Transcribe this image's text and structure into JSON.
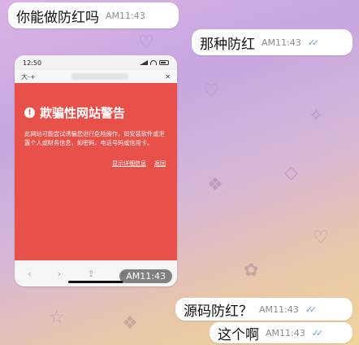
{
  "messages": [
    {
      "text": "你能做防红吗",
      "time": "AM11:43",
      "direction": "in"
    },
    {
      "text": "那种防红",
      "time": "AM11:43",
      "direction": "out",
      "read": true
    },
    {
      "text": "源码防红？",
      "time": "AM11:43",
      "direction": "out",
      "read": true
    },
    {
      "text": "这个啊",
      "time": "AM11:43",
      "direction": "out",
      "read": true
    }
  ],
  "screenshot": {
    "status_time": "12:50",
    "tab_label": "大-+",
    "close_glyph": "✕",
    "warning_icon_glyph": "!",
    "warning_title": "欺骗性网站警告",
    "warning_body": "此网站可能尝试诱骗您进行危险操作，如安装软件或泄露个人或财务信息，如密码、电话号码或信用卡。",
    "link_details": "显示详细信息",
    "link_back": "返回",
    "toolbar": {
      "back": "‹",
      "forward": "›",
      "share": "⇪",
      "books": "▭",
      "tabs": "▢"
    },
    "timestamp_overlay": "AM11:43"
  },
  "colors": {
    "warning_red": "#e8504a",
    "bubble": "#ffffff",
    "read_ticks": "#6aa0c8"
  }
}
